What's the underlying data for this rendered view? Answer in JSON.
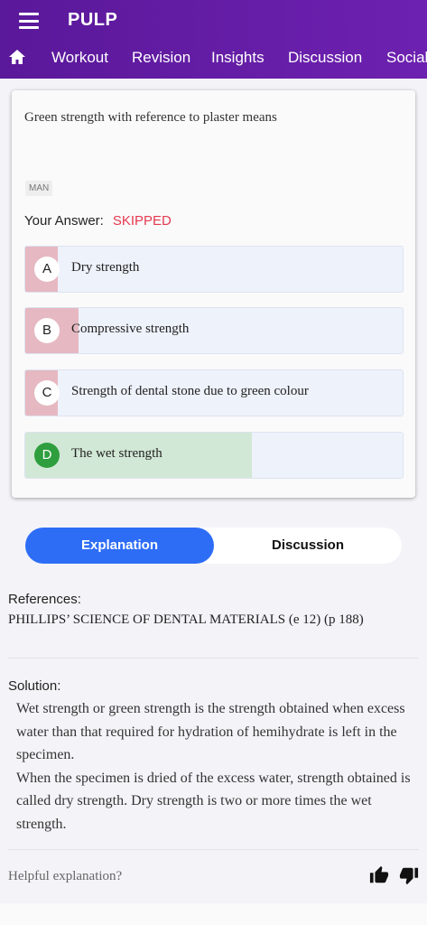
{
  "app": {
    "title": "PULP"
  },
  "nav": {
    "tabs": [
      {
        "label": "Workout"
      },
      {
        "label": "Revision"
      },
      {
        "label": "Insights"
      },
      {
        "label": "Discussion"
      },
      {
        "label": "Social"
      }
    ]
  },
  "question": {
    "text": "Green strength with reference to plaster means",
    "tag": "MAN",
    "your_answer_label": "Your Answer:",
    "your_answer_status": "SKIPPED",
    "options": [
      {
        "letter": "A",
        "text": "Dry strength",
        "fill_color": "#e6b8c1",
        "fill_fraction": 0.085,
        "correct": false
      },
      {
        "letter": "B",
        "text": "Compressive strength",
        "fill_color": "#e6b8c1",
        "fill_fraction": 0.14,
        "correct": false
      },
      {
        "letter": "C",
        "text": "Strength of dental stone due to green colour",
        "fill_color": "#e6b8c1",
        "fill_fraction": 0.085,
        "correct": false
      },
      {
        "letter": "D",
        "text": "The wet strength",
        "fill_color": "#d2e8d6",
        "fill_fraction": 0.6,
        "correct": true
      }
    ]
  },
  "toggle": {
    "active": "Explanation",
    "inactive": "Discussion"
  },
  "references": {
    "label": "References:",
    "text": "PHILLIPS’ SCIENCE OF DENTAL MATERIALS (e 12) (p 188)"
  },
  "solution": {
    "label": "Solution:",
    "paragraphs": [
      "Wet strength or green strength is the strength obtained when excess water than that required for hydration of hemihydrate is left in the specimen.",
      "When the specimen is dried of the excess water, strength obtained is called dry strength. Dry strength is two or more times the wet strength."
    ]
  },
  "feedback": {
    "prompt": "Helpful explanation?"
  }
}
